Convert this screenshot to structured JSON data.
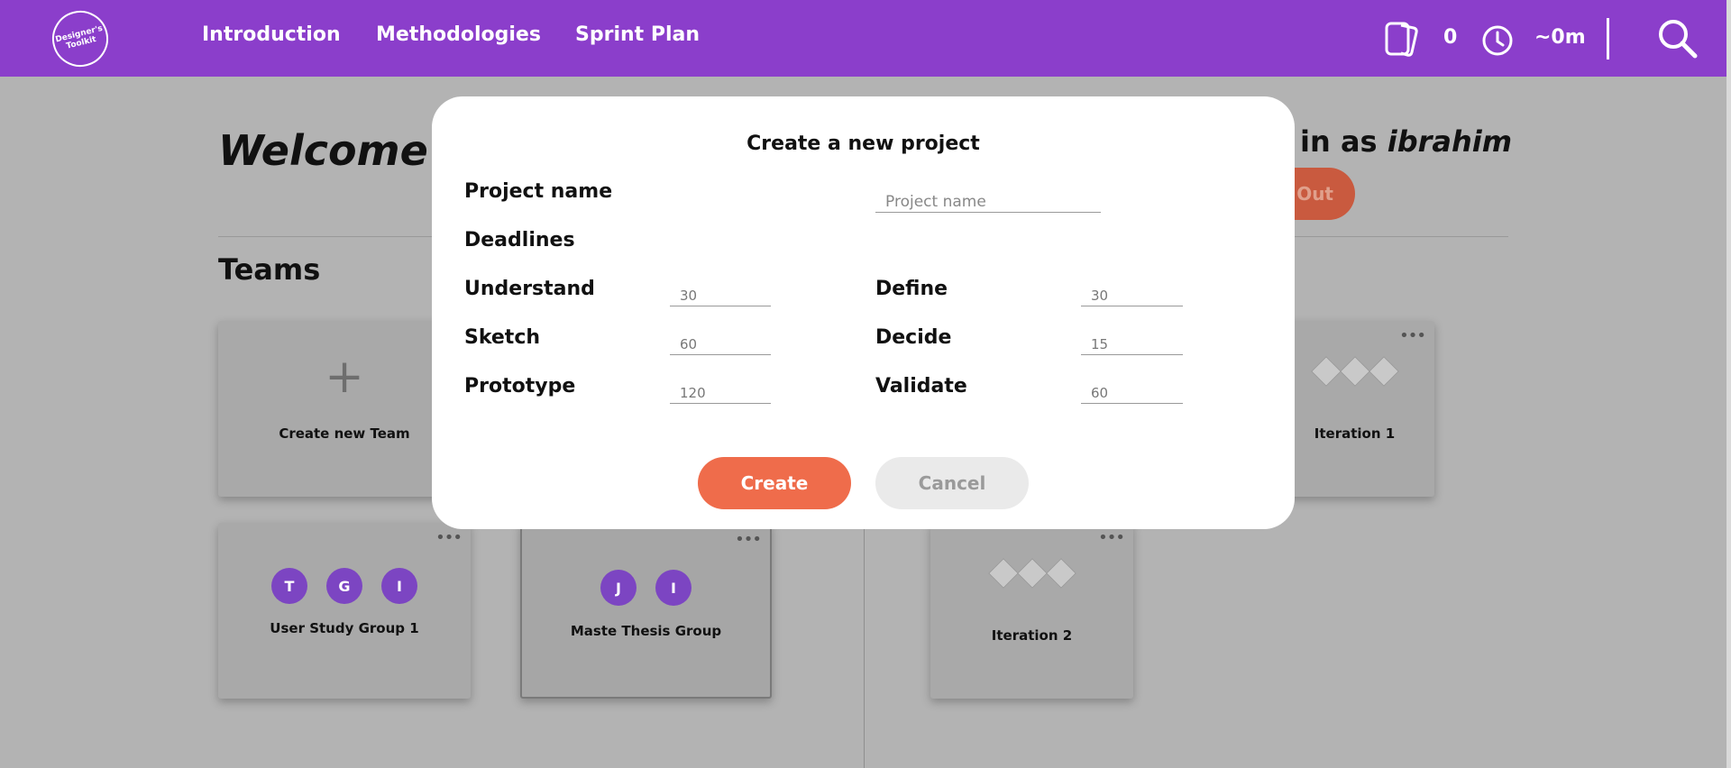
{
  "nav": {
    "logo_text": "Designer's Toolkit",
    "links": [
      "Introduction",
      "Methodologies",
      "Sprint Plan"
    ],
    "card_count": "0",
    "time_value": "~0m"
  },
  "page": {
    "welcome": "Welcome",
    "logged_in_prefix": "d in as ",
    "username": "ibrahim",
    "logout_label": "Out",
    "teams_title": "Teams",
    "create_team_label": "Create new Team",
    "teams": [
      {
        "name": "User Study Group 1",
        "members": [
          "T",
          "G",
          "I"
        ]
      },
      {
        "name": "Maste Thesis Group",
        "members": [
          "J",
          "I"
        ]
      }
    ],
    "iterations": [
      "Iteration 1",
      "Iteration 2"
    ]
  },
  "modal": {
    "title": "Create a new project",
    "project_name_label": "Project name",
    "project_name_placeholder": "Project name",
    "deadlines_label": "Deadlines",
    "phases": {
      "understand": {
        "label": "Understand",
        "value": "30"
      },
      "define": {
        "label": "Define",
        "value": "30"
      },
      "sketch": {
        "label": "Sketch",
        "value": "60"
      },
      "decide": {
        "label": "Decide",
        "value": "15"
      },
      "prototype": {
        "label": "Prototype",
        "value": "120"
      },
      "validate": {
        "label": "Validate",
        "value": "60"
      }
    },
    "create_label": "Create",
    "cancel_label": "Cancel"
  },
  "colors": {
    "nav_bg": "#8b3ecb",
    "accent": "#ef6c4b",
    "avatar": "#7c45c2",
    "overlay_bg": "#b3b3b3"
  },
  "icons": [
    "cards-icon",
    "clock-icon",
    "search-icon",
    "plus-icon",
    "more-dots-icon",
    "diamond-icon"
  ]
}
